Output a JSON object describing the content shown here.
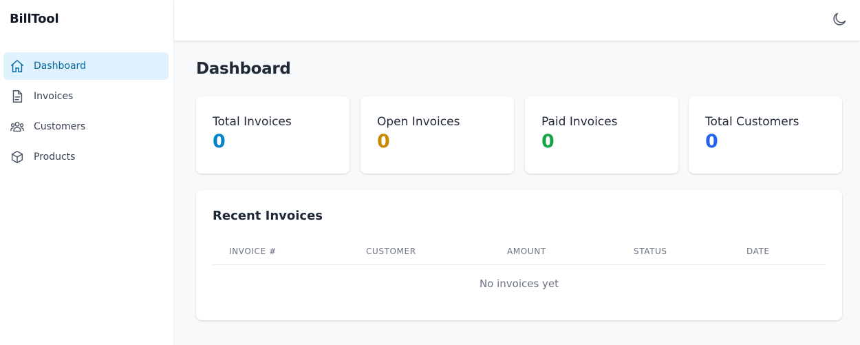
{
  "app": {
    "brand": "BillTool"
  },
  "sidebar": {
    "items": [
      {
        "label": "Dashboard",
        "icon": "home-icon",
        "active": true
      },
      {
        "label": "Invoices",
        "icon": "document-icon",
        "active": false
      },
      {
        "label": "Customers",
        "icon": "users-icon",
        "active": false
      },
      {
        "label": "Products",
        "icon": "cube-icon",
        "active": false
      }
    ]
  },
  "topbar": {
    "theme_toggle_icon": "moon-icon"
  },
  "main": {
    "title": "Dashboard",
    "stats": [
      {
        "label": "Total Invoices",
        "value": "0",
        "color": "#0284c7"
      },
      {
        "label": "Open Invoices",
        "value": "0",
        "color": "#ca8a04"
      },
      {
        "label": "Paid Invoices",
        "value": "0",
        "color": "#16a34a"
      },
      {
        "label": "Total Customers",
        "value": "0",
        "color": "#2563eb"
      }
    ],
    "recent": {
      "title": "Recent Invoices",
      "columns": [
        "INVOICE #",
        "CUSTOMER",
        "AMOUNT",
        "STATUS",
        "DATE"
      ],
      "empty_text": "No invoices yet"
    }
  },
  "colors": {
    "accent": "#0369a1",
    "accent_bg": "#e0f2fe"
  }
}
